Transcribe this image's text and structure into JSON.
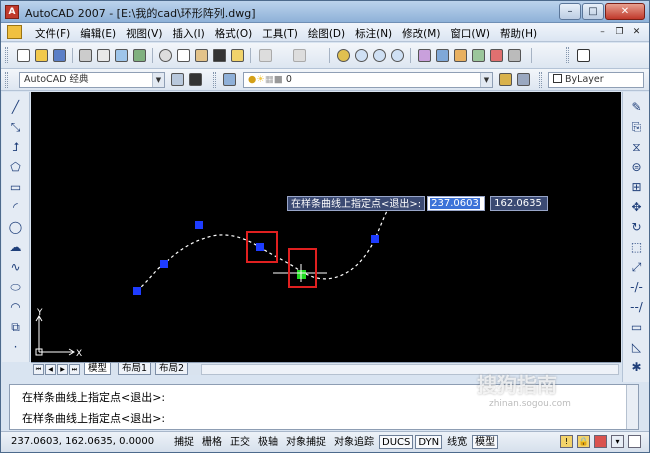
{
  "window": {
    "title": "AutoCAD 2007 - [E:\\我的cad\\环形阵列.dwg]",
    "buttons": [
      "minimize",
      "maximize",
      "close"
    ]
  },
  "menu": {
    "items": [
      "文件(F)",
      "编辑(E)",
      "视图(V)",
      "插入(I)",
      "格式(O)",
      "工具(T)",
      "绘图(D)",
      "标注(N)",
      "修改(M)",
      "窗口(W)",
      "帮助(H)"
    ]
  },
  "workspace": {
    "name": "AutoCAD 经典"
  },
  "layer": {
    "current": "0",
    "color": "ByLayer"
  },
  "drawing": {
    "background": "#000000",
    "grip_color": "#1e3cff",
    "hot_grip_color": "#22dd22",
    "highlight_box_color": "#e02020",
    "ucs_x": "X",
    "ucs_y": "Y"
  },
  "dynamic_input": {
    "prompt": "在样条曲线上指定点<退出>:",
    "x_value": "237.0603",
    "y_value": "162.0635"
  },
  "layout_tabs": [
    "模型",
    "布局1",
    "布局2"
  ],
  "command": {
    "history": "在样条曲线上指定点<退出>:",
    "current": "在样条曲线上指定点<退出>:"
  },
  "status": {
    "coordinates": "237.0603,  162.0635,  0.0000",
    "toggles": [
      {
        "label": "捕捉",
        "on": false
      },
      {
        "label": "栅格",
        "on": false
      },
      {
        "label": "正交",
        "on": false
      },
      {
        "label": "极轴",
        "on": false
      },
      {
        "label": "对象捕捉",
        "on": false
      },
      {
        "label": "对象追踪",
        "on": false
      },
      {
        "label": "DUCS",
        "on": true
      },
      {
        "label": "DYN",
        "on": true
      },
      {
        "label": "线宽",
        "on": false
      },
      {
        "label": "模型",
        "on": true
      }
    ]
  },
  "watermark": {
    "text": "搜狗指南",
    "sub": "zhinan.sogou.com"
  }
}
